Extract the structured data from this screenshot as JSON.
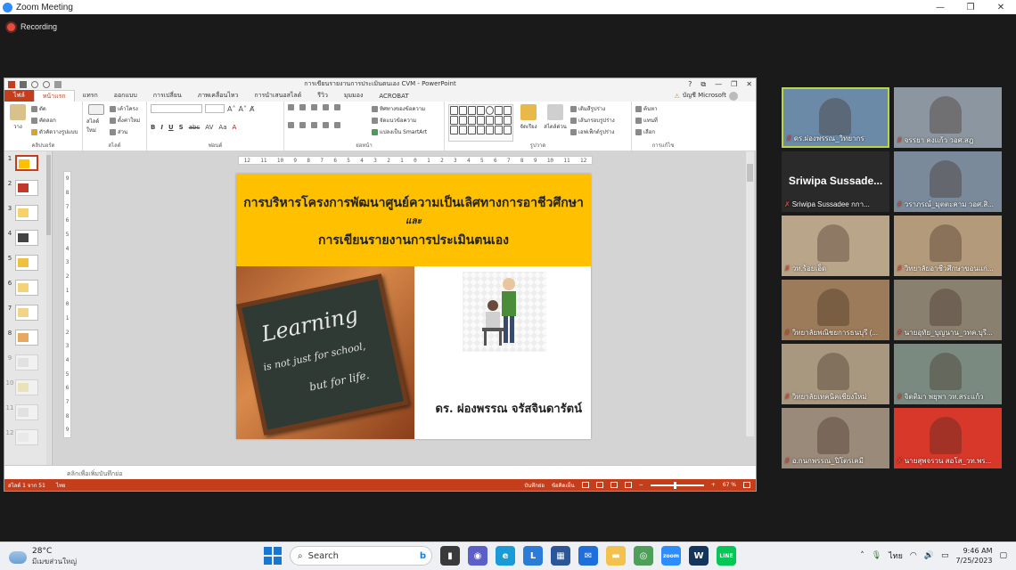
{
  "zoom": {
    "title": "Zoom Meeting",
    "recording_label": "Recording",
    "controls": {
      "minimize": "—",
      "restore": "❐",
      "close": "✕"
    }
  },
  "ppt": {
    "doc_title": "การเขียนรายงานการประเมินตนเอง CVM - PowerPoint",
    "title_controls": [
      "?",
      "⧉",
      "—",
      "❐",
      "✕"
    ],
    "account": "บัญชี Microsoft",
    "tabs": [
      "ไฟล์",
      "หน้าแรก",
      "แทรก",
      "ออกแบบ",
      "การเปลี่ยน",
      "ภาพเคลื่อนไหว",
      "การนำเสนอสไลด์",
      "รีวิว",
      "มุมมอง",
      "ACROBAT"
    ],
    "active_tab_index": 1,
    "groups": {
      "clipboard": {
        "label": "คลิปบอร์ด",
        "paste": "วาง",
        "cut": "ตัด",
        "copy": "คัดลอก",
        "format": "ตัวคัดวางรูปแบบ"
      },
      "slides": {
        "label": "สไลด์",
        "new": "สไลด์ใหม่",
        "layout": "เค้าโครง",
        "reset": "ตั้งค่าใหม่",
        "section": "ส่วน"
      },
      "font": {
        "label": "ฟอนต์"
      },
      "paragraph": {
        "label": "ย่อหน้า",
        "direction": "ทิศทางของข้อความ",
        "align": "จัดแนวข้อความ",
        "smartart": "แปลงเป็น SmartArt"
      },
      "drawing": {
        "label": "รูปวาด",
        "arrange": "จัดเรียง",
        "styles": "สไตล์ด่วน",
        "fill": "เติมสีรูปร่าง",
        "outline": "เส้นกรอบรูปร่าง",
        "effects": "เอฟเฟ็กต์รูปร่าง"
      },
      "editing": {
        "label": "การแก้ไข",
        "find": "ค้นหา",
        "replace": "แทนที่",
        "select": "เลือก"
      }
    },
    "ruler_h": [
      "12",
      "11",
      "10",
      "9",
      "8",
      "7",
      "6",
      "5",
      "4",
      "3",
      "2",
      "1",
      "0",
      "1",
      "2",
      "3",
      "4",
      "5",
      "6",
      "7",
      "8",
      "9",
      "10",
      "11",
      "12"
    ],
    "ruler_v": [
      "9",
      "8",
      "7",
      "6",
      "5",
      "4",
      "3",
      "2",
      "1",
      "0",
      "1",
      "2",
      "3",
      "4",
      "5",
      "6",
      "7",
      "8",
      "9"
    ],
    "thumbnails": [
      "1",
      "2",
      "3",
      "4",
      "5",
      "6",
      "7",
      "8",
      "9",
      "10",
      "11",
      "12"
    ],
    "selected_slide": 1,
    "slide": {
      "line1": "การบริหารโครงการพัฒนาศูนย์ความเป็นเลิศทางการอาชีวศึกษา",
      "line2": "และ",
      "line3": "การเขียนรายงานการประเมินตนเอง",
      "chalk1": "Learning",
      "chalk2": "is not just for school,",
      "chalk3": "but for life.",
      "presenter": "ดร. ผ่องพรรณ จรัสจินดารัตน์"
    },
    "notes_placeholder": "คลิกเพื่อเพิ่มบันทึกย่อ",
    "status": {
      "slide_count": "สไลด์ 1 จาก 51",
      "language": "ไทย",
      "notes": "บันทึกย่อ",
      "comments": "ข้อคิดเห็น",
      "zoom": "67 %",
      "zoom_minus": "−",
      "zoom_plus": "+"
    }
  },
  "gallery": [
    {
      "name": "ดร.ผ่องพรรณ_วิทยากร",
      "active": true,
      "bg": "#6b8aa8"
    },
    {
      "name": "จรรยา คงแก้ว วอศ.สฎ",
      "active": false,
      "bg": "#8c96a0"
    },
    {
      "name": "Sriwipa Sussadee กกา...",
      "big": "Sriwipa Sussade...",
      "active": false,
      "bg": "#2a2a2a"
    },
    {
      "name": "วราภรณ์_มุตตะคาม วอศ.สิ...",
      "active": false,
      "bg": "#7a8a9a"
    },
    {
      "name": "วท.ร้อยเอ็ด",
      "active": false,
      "bg": "#b9a58a"
    },
    {
      "name": "วิทยาลัยอาชีวศึกษาขอนแก่...",
      "active": false,
      "bg": "#b39a7a"
    },
    {
      "name": "วิทยาลัยพณิชยการธนบุรี (...",
      "active": false,
      "bg": "#9c7b5a"
    },
    {
      "name": "นายอุทัย_บุญนาน_วทค.บุรี...",
      "active": false,
      "bg": "#8a8070"
    },
    {
      "name": "วิทยาลัยเทคนิคเชียงใหม่",
      "active": false,
      "bg": "#a89880"
    },
    {
      "name": "จิตติมา พยุพา วท.สระแก้ว",
      "active": false,
      "bg": "#7a8a80"
    },
    {
      "name": "อ.กนกพรรณ_ปิโตรเคมี",
      "active": false,
      "bg": "#9a8a7a"
    },
    {
      "name": "นายสุพจรวน สอโส_วท.พร...",
      "active": false,
      "bg": "#d8382a"
    }
  ],
  "taskbar": {
    "temp": "28°C",
    "weather_desc": "มีเมฆส่วนใหญ่",
    "search_placeholder": "Search",
    "lang": "ไทย",
    "time": "9:46 AM",
    "date": "7/25/2023",
    "apps": [
      {
        "name": "file-explorer-icon",
        "color": "#3a3a3a",
        "glyph": "▮"
      },
      {
        "name": "teams-icon",
        "color": "#5b5fc7",
        "glyph": "◉"
      },
      {
        "name": "edge-icon",
        "color": "#1a9bd7",
        "glyph": "e"
      },
      {
        "name": "l-app-icon",
        "color": "#2b7bd8",
        "glyph": "L"
      },
      {
        "name": "store-icon",
        "color": "#2b5797",
        "glyph": "▦"
      },
      {
        "name": "mail-icon",
        "color": "#1e6fd9",
        "glyph": "✉"
      },
      {
        "name": "folder-icon",
        "color": "#f2c14e",
        "glyph": "▬"
      },
      {
        "name": "chrome-icon",
        "color": "#4f9e5a",
        "glyph": "◎"
      },
      {
        "name": "zoom-icon",
        "color": "#2d8cff",
        "glyph": "zoom"
      },
      {
        "name": "webex-icon",
        "color": "#14365c",
        "glyph": "W"
      },
      {
        "name": "line-icon",
        "color": "#06c755",
        "glyph": "LINE"
      }
    ]
  }
}
